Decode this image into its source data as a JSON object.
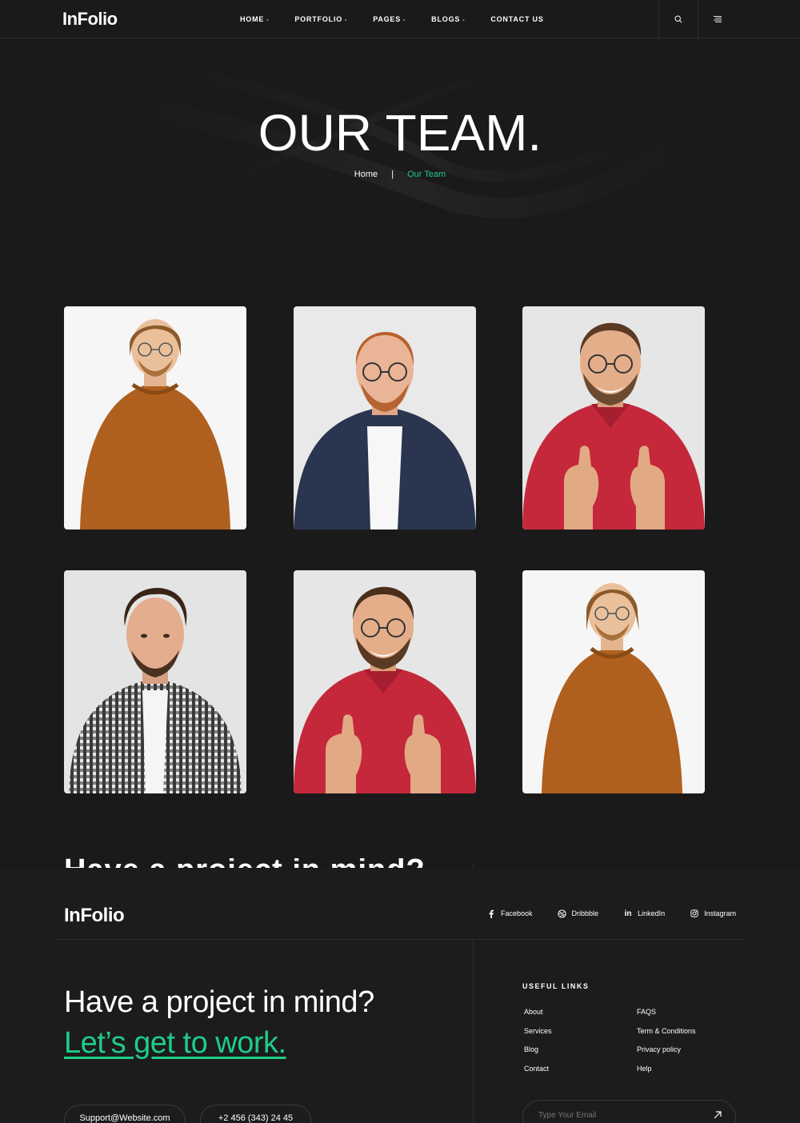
{
  "brand": {
    "logo": "InFolio",
    "accent": "#1ecc8a",
    "background": "#1a1a1a"
  },
  "nav": {
    "items": [
      {
        "label": "HOME",
        "caret": "-"
      },
      {
        "label": "PORTFOLIO",
        "caret": "-"
      },
      {
        "label": "PAGES",
        "caret": "-"
      },
      {
        "label": "BLOGS",
        "caret": "-"
      },
      {
        "label": "CONTACT US",
        "caret": ""
      }
    ],
    "icons": [
      "search-icon",
      "menu-icon"
    ]
  },
  "hero": {
    "title": "OUR TEAM.",
    "breadcrumb": {
      "home": "Home",
      "separator": "|",
      "current": "Our Team"
    }
  },
  "team": {
    "members": [
      {
        "photo": "man-orange-sweater",
        "sweater": "#b0601e"
      },
      {
        "photo": "man-navy-shirt",
        "shirt": "#2a3550"
      },
      {
        "photo": "man-red-polo-thumbs-up",
        "shirt": "#c4283a"
      },
      {
        "photo": "man-checkered-shirt",
        "shirt": "#3a3a3a"
      },
      {
        "photo": "man-red-polo-thumbs-up",
        "shirt": "#c4283a"
      },
      {
        "photo": "man-orange-sweater",
        "sweater": "#b0601e"
      }
    ]
  },
  "ghost_text": "Have a project in mind?",
  "footer": {
    "logo": "InFolio",
    "socials": [
      {
        "icon": "facebook-icon",
        "label": "Facebook"
      },
      {
        "icon": "dribbble-icon",
        "label": "Dribbble"
      },
      {
        "icon": "linkedin-icon",
        "label": "LinkedIn"
      },
      {
        "icon": "instagram-icon",
        "label": "Instagram"
      }
    ],
    "cta_line1": "Have a project in mind?",
    "cta_line2": "Let’s get to work.",
    "email": "Support@Website.com",
    "phone": "+2 456 (343) 24 45",
    "useful_links_title": "USEFUL LINKS",
    "links_col1": [
      "About",
      "Services",
      "Blog",
      "Contact"
    ],
    "links_col2": [
      "FAQS",
      "Term & Conditions",
      "Privacy policy",
      "Help"
    ],
    "subscribe_placeholder": "Type Your Email"
  }
}
